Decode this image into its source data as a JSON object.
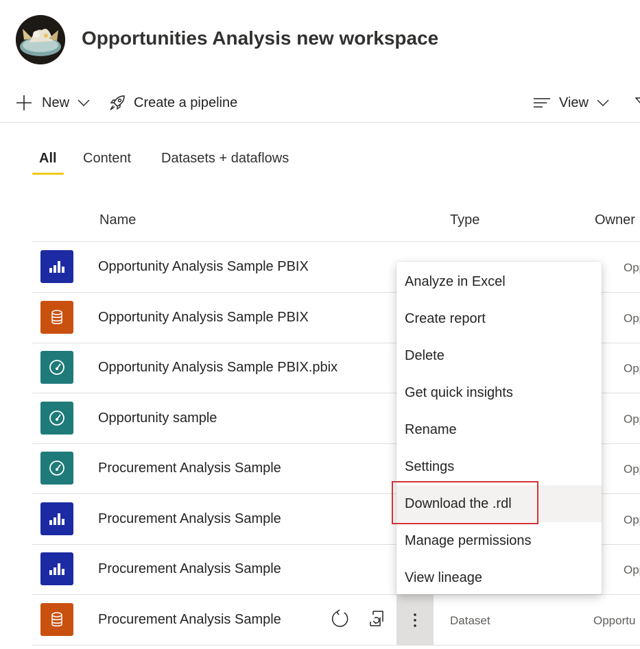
{
  "workspace": {
    "title": "Opportunities Analysis new workspace"
  },
  "toolbar": {
    "new_label": "New",
    "pipeline_label": "Create a pipeline",
    "view_label": "View"
  },
  "tabs": [
    {
      "label": "All",
      "active": true
    },
    {
      "label": "Content",
      "active": false
    },
    {
      "label": "Datasets + dataflows",
      "active": false
    }
  ],
  "table": {
    "columns": {
      "name": "Name",
      "type": "Type",
      "owner": "Owner"
    },
    "rows": [
      {
        "name": "Opportunity Analysis Sample PBIX",
        "icon": "report-icon",
        "type": "",
        "owner": "Opportu"
      },
      {
        "name": "Opportunity Analysis Sample PBIX",
        "icon": "dataset-icon",
        "type": "",
        "owner": "Opportu"
      },
      {
        "name": "Opportunity Analysis Sample PBIX.pbix",
        "icon": "dashboard-icon",
        "type": "",
        "owner": "Opportu"
      },
      {
        "name": "Opportunity sample",
        "icon": "dashboard-icon",
        "type": "",
        "owner": "Opportu"
      },
      {
        "name": "Procurement Analysis Sample",
        "icon": "dashboard-icon",
        "type": "",
        "owner": "Opportu"
      },
      {
        "name": "Procurement Analysis Sample",
        "icon": "report-icon",
        "type": "",
        "owner": "Opportu"
      },
      {
        "name": "Procurement Analysis Sample",
        "icon": "report-icon",
        "type": "",
        "owner": "Opportu"
      },
      {
        "name": "Procurement Analysis Sample",
        "icon": "dataset-icon",
        "type": "Dataset",
        "owner": "Opportu"
      }
    ]
  },
  "context_menu": {
    "items": [
      "Analyze in Excel",
      "Create report",
      "Delete",
      "Get quick insights",
      "Rename",
      "Settings",
      "Download the .rdl",
      "Manage permissions",
      "View lineage"
    ],
    "highlighted_index": 6
  },
  "colors": {
    "report": "#1c2aa3",
    "dataset": "#ca5010",
    "dashboard": "#1f7a7a",
    "tab_accent": "#f2c811",
    "highlight_border": "#d13438"
  }
}
